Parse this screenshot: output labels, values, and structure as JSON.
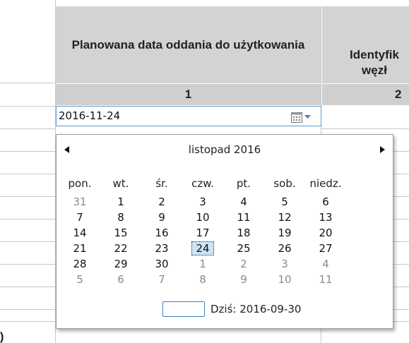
{
  "columns": [
    {
      "header": "Planowana data oddania do użytkowania",
      "number": "1"
    },
    {
      "header": "Identyfik\nwęzł",
      "number": "2"
    }
  ],
  "row_label_partial": ")",
  "date_input": {
    "value": "2016-11-24"
  },
  "calendar": {
    "month_label": "listopad 2016",
    "prev_icon": "triangle-left-icon",
    "next_icon": "triangle-right-icon",
    "weekdays": [
      "pon.",
      "wt.",
      "śr.",
      "czw.",
      "pt.",
      "sob.",
      "niedz."
    ],
    "weeks": [
      [
        "31",
        "1",
        "2",
        "3",
        "4",
        "5",
        "6"
      ],
      [
        "7",
        "8",
        "9",
        "10",
        "11",
        "12",
        "13"
      ],
      [
        "14",
        "15",
        "16",
        "17",
        "18",
        "19",
        "20"
      ],
      [
        "21",
        "22",
        "23",
        "24",
        "25",
        "26",
        "27"
      ],
      [
        "28",
        "29",
        "30",
        "1",
        "2",
        "3",
        "4"
      ],
      [
        "5",
        "6",
        "7",
        "8",
        "9",
        "10",
        "11"
      ]
    ],
    "selected_day": "24",
    "today_label": "Dziś: 2016-09-30"
  },
  "colors": {
    "header_bg": "#d3d3d3",
    "accent": "#5b9bd5",
    "selected_bg": "#cce4f7",
    "other_month": "#8a8a8a"
  }
}
